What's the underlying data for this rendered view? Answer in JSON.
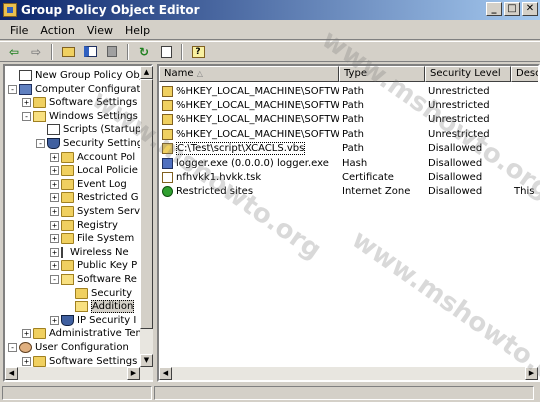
{
  "window": {
    "title": "Group Policy Object Editor",
    "minimize": "_",
    "maximize": "□",
    "close": "✕"
  },
  "menu": [
    {
      "label": "File"
    },
    {
      "label": "Action"
    },
    {
      "label": "View"
    },
    {
      "label": "Help"
    }
  ],
  "toolbar": {
    "buttons": [
      "back-icon",
      "forward-icon",
      "up-folder-icon",
      "show-hide-tree-icon",
      "delete-icon",
      "refresh-icon",
      "export-list-icon",
      "help-icon"
    ]
  },
  "tree": [
    {
      "label": "New Group Policy Object [D",
      "depth": 0,
      "icon": "doc",
      "exp": ""
    },
    {
      "label": "Computer Configuration",
      "depth": 0,
      "icon": "computer",
      "exp": "-"
    },
    {
      "label": "Software Settings",
      "depth": 1,
      "icon": "folder",
      "exp": "+"
    },
    {
      "label": "Windows Settings",
      "depth": 1,
      "icon": "folder-open",
      "exp": "-"
    },
    {
      "label": "Scripts (Startup",
      "depth": 2,
      "icon": "doc",
      "exp": ""
    },
    {
      "label": "Security Setting",
      "depth": 2,
      "icon": "shield",
      "exp": "-"
    },
    {
      "label": "Account Pol",
      "depth": 3,
      "icon": "folder",
      "exp": "+"
    },
    {
      "label": "Local Policie",
      "depth": 3,
      "icon": "folder",
      "exp": "+"
    },
    {
      "label": "Event Log",
      "depth": 3,
      "icon": "folder",
      "exp": "+"
    },
    {
      "label": "Restricted G",
      "depth": 3,
      "icon": "folder",
      "exp": "+"
    },
    {
      "label": "System Serv",
      "depth": 3,
      "icon": "folder",
      "exp": "+"
    },
    {
      "label": "Registry",
      "depth": 3,
      "icon": "folder",
      "exp": "+"
    },
    {
      "label": "File System",
      "depth": 3,
      "icon": "folder",
      "exp": "+"
    },
    {
      "label": "Wireless Ne",
      "depth": 3,
      "icon": "antenna",
      "exp": "+"
    },
    {
      "label": "Public Key P",
      "depth": 3,
      "icon": "folder",
      "exp": "+"
    },
    {
      "label": "Software Re",
      "depth": 3,
      "icon": "folder-open",
      "exp": "-"
    },
    {
      "label": "Security",
      "depth": 4,
      "icon": "folder",
      "exp": ""
    },
    {
      "label": "Addition",
      "depth": 4,
      "icon": "folder-open",
      "exp": "",
      "selected": true
    },
    {
      "label": "IP Security I",
      "depth": 3,
      "icon": "shield",
      "exp": "+"
    },
    {
      "label": "Administrative Temp",
      "depth": 1,
      "icon": "folder",
      "exp": "+"
    },
    {
      "label": "User Configuration",
      "depth": 0,
      "icon": "user",
      "exp": "-"
    },
    {
      "label": "Software Settings",
      "depth": 1,
      "icon": "folder",
      "exp": "+"
    }
  ],
  "columns": [
    "Name",
    "Type",
    "Security Level",
    "Descr"
  ],
  "rows": [
    {
      "name": "%HKEY_LOCAL_MACHINE\\SOFTWA...",
      "type": "Path",
      "level": "Unrestricted",
      "desc": "",
      "icon": "path"
    },
    {
      "name": "%HKEY_LOCAL_MACHINE\\SOFTWA...",
      "type": "Path",
      "level": "Unrestricted",
      "desc": "",
      "icon": "path"
    },
    {
      "name": "%HKEY_LOCAL_MACHINE\\SOFTWA...",
      "type": "Path",
      "level": "Unrestricted",
      "desc": "",
      "icon": "path"
    },
    {
      "name": "%HKEY_LOCAL_MACHINE\\SOFTWA...",
      "type": "Path",
      "level": "Unrestricted",
      "desc": "",
      "icon": "path"
    },
    {
      "name": "C:\\Test\\script\\XCACLS.vbs",
      "type": "Path",
      "level": "Disallowed",
      "desc": "",
      "icon": "path",
      "focused": true
    },
    {
      "name": "logger.exe (0.0.0.0)  logger.exe",
      "type": "Hash",
      "level": "Disallowed",
      "desc": "",
      "icon": "hash"
    },
    {
      "name": "nfhvkk1.hvkk.tsk",
      "type": "Certificate",
      "level": "Disallowed",
      "desc": "",
      "icon": "cert"
    },
    {
      "name": "Restricted sites",
      "type": "Internet Zone",
      "level": "Disallowed",
      "desc": "This z",
      "icon": "zone"
    }
  ],
  "watermark": "www.mshowto.org",
  "colors": {
    "titlebar": "#0a246a",
    "face": "#d4d0c8"
  }
}
